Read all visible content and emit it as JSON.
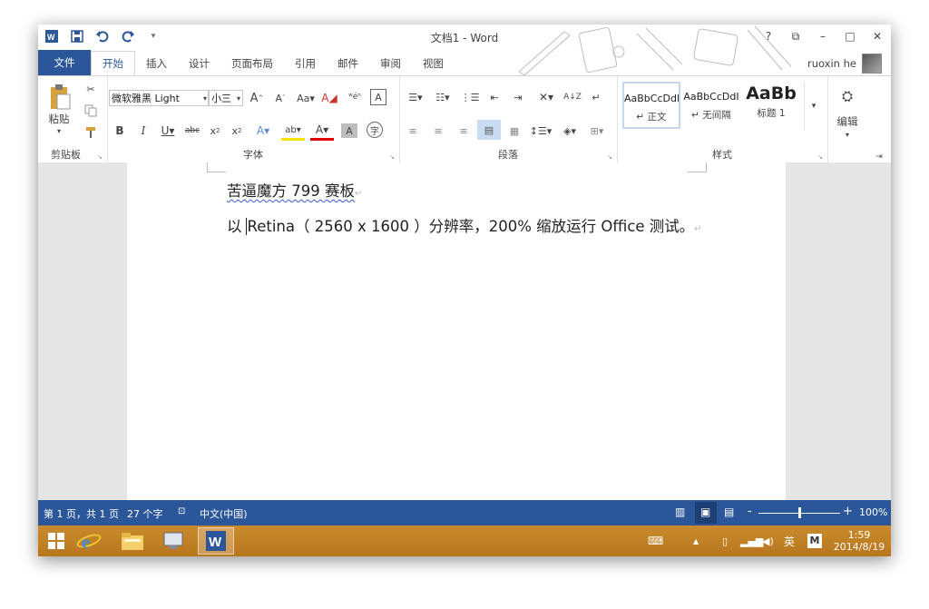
{
  "window": {
    "title": "文档1 - Word"
  },
  "title_controls": [
    "?",
    "⧉",
    "–",
    "□",
    "✕"
  ],
  "tabs": [
    "文件",
    "开始",
    "插入",
    "设计",
    "页面布局",
    "引用",
    "邮件",
    "审阅",
    "视图"
  ],
  "user": {
    "name": "ruoxin he"
  },
  "ribbon": {
    "clipboard": {
      "label": "剪贴板",
      "paste": "粘贴"
    },
    "font": {
      "label": "字体",
      "family": "微软雅黑 Light",
      "size": "小三"
    },
    "paragraph": {
      "label": "段落"
    },
    "styles": {
      "label": "样式",
      "items": [
        {
          "sample": "AaBbCcDdI",
          "name": "↵ 正文"
        },
        {
          "sample": "AaBbCcDdI",
          "name": "↵ 无间隔"
        },
        {
          "sample": "AaBb",
          "name": "标题 1"
        }
      ]
    },
    "editing": {
      "label": "编辑"
    }
  },
  "document": {
    "line1": "苦逼魔方 799 赛板",
    "line2_prefix": "以",
    "line2_rest": "Retina（ 2560 x 1600 ）分辨率，200%  缩放运行 Office 测试。"
  },
  "status": {
    "page": "第 1 页，共 1 页",
    "words": "27 个字",
    "language": "中文(中国)",
    "zoom_minus": "-",
    "zoom_plus": "+",
    "zoom": "100%",
    "zoom_level_fraction": 0.5
  },
  "taskbar": {
    "ime": "英",
    "ime_mode": "M",
    "time": "1:59",
    "date": "2014/8/19"
  },
  "colors": {
    "word_blue": "#2b579a",
    "taskbar": "#c98b2c"
  }
}
